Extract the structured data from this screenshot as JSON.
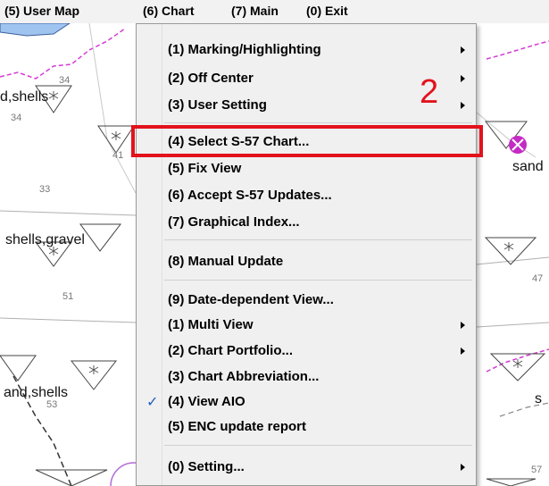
{
  "menubar": {
    "items": [
      "(5) User Map",
      "(6) Chart",
      "(7) Main",
      "(0) Exit"
    ]
  },
  "chart": {
    "depth_labels": [
      "34",
      "34",
      "41",
      "33",
      "51",
      "53",
      "47",
      "57"
    ],
    "seabed_labels": [
      "d,shells",
      "shells,gravel",
      "and,shells",
      "sand",
      "s"
    ]
  },
  "dropdown": {
    "items": [
      {
        "label": "(1) Marking/Highlighting",
        "submenu": true
      },
      {
        "label": "(2) Off Center",
        "submenu": true
      },
      {
        "label": "(3) User Setting",
        "submenu": true
      },
      {
        "label": "(4) Select S-57 Chart...",
        "submenu": false
      },
      {
        "label": "(5) Fix View",
        "submenu": false
      },
      {
        "label": "(6) Accept S-57 Updates...",
        "submenu": false
      },
      {
        "label": "(7) Graphical Index...",
        "submenu": false
      },
      {
        "label": "(8) Manual Update",
        "submenu": false
      },
      {
        "label": "(9) Date-dependent View...",
        "submenu": false
      },
      {
        "label": "(1) Multi View",
        "submenu": true
      },
      {
        "label": "(2) Chart Portfolio...",
        "submenu": true
      },
      {
        "label": "(3) Chart Abbreviation...",
        "submenu": false
      },
      {
        "label": "(4) View AIO",
        "submenu": false,
        "checked": true
      },
      {
        "label": "(5) ENC update report",
        "submenu": false
      },
      {
        "label": "(0) Setting...",
        "submenu": true
      }
    ]
  },
  "annotation": {
    "step_number": "2",
    "color": "#e2121c"
  }
}
